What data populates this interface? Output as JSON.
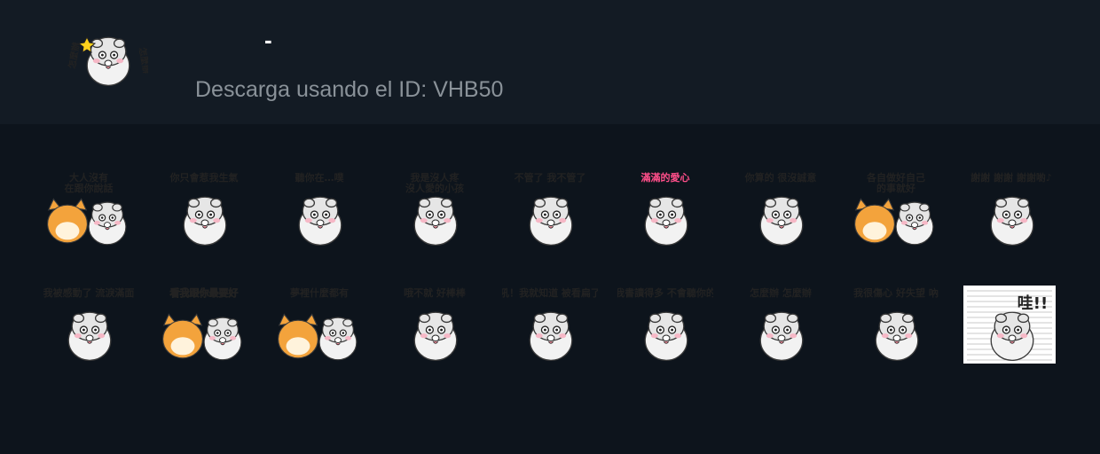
{
  "pack": {
    "title": "-",
    "download_text": "Descarga usando el ID: VHB50",
    "icon": "white-seal-character-icon"
  },
  "stickers": [
    {
      "caption": "大人沒有\n在跟你說話",
      "icon": "sticker-seal-with-shiba-icon"
    },
    {
      "caption": "你只會惹我生氣",
      "icon": "sticker-seal-lying-icon"
    },
    {
      "caption": "聽你在…噗",
      "icon": "sticker-seal-laughing-icon"
    },
    {
      "caption": "我是沒人疼\n沒人愛的小孩",
      "icon": "sticker-seal-rain-icon"
    },
    {
      "caption": "不管了 我不管了",
      "icon": "sticker-seal-flopping-icon"
    },
    {
      "caption": "滿滿的愛心",
      "icon": "sticker-seal-phone-heart-icon"
    },
    {
      "caption": "你算的 很沒誠意",
      "icon": "sticker-seal-sparkle-icon"
    },
    {
      "caption": "各自做好自己\n的事就好",
      "icon": "sticker-seal-shiba-sofa-icon"
    },
    {
      "caption": "謝謝 謝謝 謝謝喲♪",
      "icon": "sticker-seal-thanks-icon"
    },
    {
      "caption": "我被感動了 流淚滿面",
      "icon": "sticker-seal-crying-pink-icon"
    },
    {
      "caption": "看我跟你最要好",
      "icon": "sticker-seal-shiba-hug-icon"
    },
    {
      "caption": "夢裡什麼都有",
      "icon": "sticker-seal-dreaming-icon"
    },
    {
      "caption": "哦不就 好棒棒",
      "icon": "sticker-seal-thumbs-icon"
    },
    {
      "caption": "吼！我就知道 被看扁了",
      "icon": "sticker-seal-newspaper-icon"
    },
    {
      "caption": "我書讀得多 不會聽你的",
      "icon": "sticker-seal-book-icon"
    },
    {
      "caption": "怎麼辦 怎麼辦",
      "icon": "sticker-seal-surprised-icon"
    },
    {
      "caption": "我很傷心 好失望 吶",
      "icon": "sticker-seal-sad-icon"
    },
    {
      "caption": "哇!!",
      "icon": "sticker-seal-shocked-icon"
    }
  ]
}
